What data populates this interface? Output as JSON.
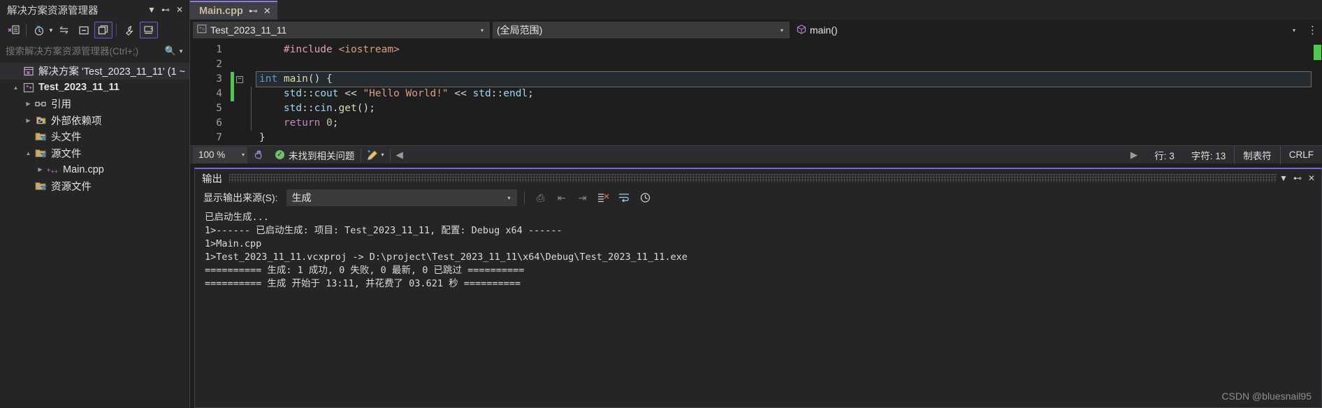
{
  "solution_explorer": {
    "title": "解决方案资源管理器",
    "title_buttons": [
      {
        "name": "dropdown",
        "glyph": "▼"
      },
      {
        "name": "pin",
        "glyph": "⊷"
      },
      {
        "name": "close",
        "glyph": "✕"
      }
    ],
    "toolbar": [
      {
        "name": "home-icon",
        "glyph": "⧉"
      },
      {
        "name": "pending-changes-icon",
        "glyph": "◷"
      },
      {
        "name": "sync-icon",
        "glyph": "⇆"
      },
      {
        "name": "collapse-all-icon",
        "glyph": "⊟"
      },
      {
        "name": "show-all-files-icon",
        "glyph": "❐"
      },
      {
        "name": "properties-icon",
        "glyph": "🔧"
      },
      {
        "name": "preview-icon",
        "glyph": "⛭"
      }
    ],
    "search_placeholder": "搜索解决方案资源管理器(Ctrl+;)",
    "search_value": "",
    "tree": [
      {
        "label": "解决方案 'Test_2023_11_11' (1 ~",
        "indent": 0,
        "expander": "",
        "icon": "solution-icon",
        "bold": false,
        "selected": true
      },
      {
        "label": "Test_2023_11_11",
        "indent": 1,
        "expander": "▲",
        "icon": "cpp-project-icon",
        "bold": true,
        "selected": false
      },
      {
        "label": "引用",
        "indent": 2,
        "expander": "▶",
        "icon": "references-icon",
        "bold": false,
        "selected": false
      },
      {
        "label": "外部依赖项",
        "indent": 2,
        "expander": "▶",
        "icon": "external-deps-icon",
        "bold": false,
        "selected": false
      },
      {
        "label": "头文件",
        "indent": 3,
        "expander": "",
        "icon": "filter-folder-icon",
        "bold": false,
        "selected": false
      },
      {
        "label": "源文件",
        "indent": 2,
        "expander": "▲",
        "icon": "filter-folder-icon",
        "bold": false,
        "selected": false
      },
      {
        "label": "Main.cpp",
        "indent": 3,
        "expander": "▶",
        "icon": "cpp-file-icon",
        "bold": false,
        "selected": false
      },
      {
        "label": "资源文件",
        "indent": 3,
        "expander": "",
        "icon": "filter-folder-icon",
        "bold": false,
        "selected": false
      }
    ]
  },
  "editor": {
    "tab": {
      "label": "Main.cpp",
      "pin_glyph": "⊷",
      "close_glyph": "✕"
    },
    "nav": {
      "project": "Test_2023_11_11",
      "scope": "(全局范围)",
      "member": "main()",
      "caret": "▾",
      "overflow": "⋮"
    },
    "code_lines": [
      {
        "n": "1",
        "changed": false,
        "fold": "",
        "guide": false,
        "highlight": false,
        "tokens": [
          {
            "t": "    ",
            "c": "tok-punct"
          },
          {
            "t": "#include",
            "c": "tok-pre"
          },
          {
            "t": " ",
            "c": "tok-punct"
          },
          {
            "t": "<iostream>",
            "c": "tok-hdr"
          }
        ]
      },
      {
        "n": "2",
        "changed": false,
        "fold": "",
        "guide": false,
        "highlight": false,
        "tokens": []
      },
      {
        "n": "3",
        "changed": true,
        "fold": "−",
        "guide": false,
        "highlight": true,
        "tokens": [
          {
            "t": "int",
            "c": "tok-kw"
          },
          {
            "t": " ",
            "c": "tok-punct"
          },
          {
            "t": "main",
            "c": "tok-fn"
          },
          {
            "t": "() {",
            "c": "tok-brace"
          }
        ]
      },
      {
        "n": "4",
        "changed": true,
        "fold": "",
        "guide": true,
        "highlight": false,
        "tokens": [
          {
            "t": "    ",
            "c": "tok-punct"
          },
          {
            "t": "std",
            "c": "tok-ns"
          },
          {
            "t": "::",
            "c": "tok-punct"
          },
          {
            "t": "cout",
            "c": "tok-ns"
          },
          {
            "t": " << ",
            "c": "tok-op"
          },
          {
            "t": "\"Hello World!\"",
            "c": "tok-str"
          },
          {
            "t": " << ",
            "c": "tok-op"
          },
          {
            "t": "std",
            "c": "tok-ns"
          },
          {
            "t": "::",
            "c": "tok-punct"
          },
          {
            "t": "endl",
            "c": "tok-ns"
          },
          {
            "t": ";",
            "c": "tok-punct"
          }
        ]
      },
      {
        "n": "5",
        "changed": false,
        "fold": "",
        "guide": true,
        "highlight": false,
        "tokens": [
          {
            "t": "    ",
            "c": "tok-punct"
          },
          {
            "t": "std",
            "c": "tok-ns"
          },
          {
            "t": "::",
            "c": "tok-punct"
          },
          {
            "t": "cin",
            "c": "tok-ns"
          },
          {
            "t": ".",
            "c": "tok-punct"
          },
          {
            "t": "get",
            "c": "tok-fn"
          },
          {
            "t": "();",
            "c": "tok-punct"
          }
        ]
      },
      {
        "n": "6",
        "changed": false,
        "fold": "",
        "guide": true,
        "highlight": false,
        "tokens": [
          {
            "t": "    ",
            "c": "tok-punct"
          },
          {
            "t": "return",
            "c": "tok-kwp"
          },
          {
            "t": " ",
            "c": "tok-punct"
          },
          {
            "t": "0",
            "c": "tok-num"
          },
          {
            "t": ";",
            "c": "tok-punct"
          }
        ]
      },
      {
        "n": "7",
        "changed": false,
        "fold": "",
        "guide": false,
        "highlight": false,
        "tokens": [
          {
            "t": "}",
            "c": "tok-brace"
          }
        ]
      }
    ],
    "status": {
      "zoom": "100 %",
      "zoom_caret": "▾",
      "hand_icon": "✋",
      "ok_glyph": "✓",
      "issues": "未找到相关问题",
      "brush_icon": "🖌",
      "brush_caret": "▾",
      "prev_arrow": "◀",
      "next_arrow": "▶",
      "line": "行: 3",
      "column": "字符: 13",
      "tabs": "制表符",
      "eol": "CRLF"
    }
  },
  "output": {
    "title": "输出",
    "header_buttons": [
      {
        "name": "dropdown",
        "glyph": "▼"
      },
      {
        "name": "pin",
        "glyph": "⊷"
      },
      {
        "name": "close",
        "glyph": "✕"
      }
    ],
    "source_label": "显示输出来源(S):",
    "source_value": "生成",
    "source_caret": "▾",
    "toolbar_buttons": [
      {
        "name": "save-output-icon",
        "glyph": "⎙",
        "enabled": false
      },
      {
        "name": "go-to-previous-icon",
        "glyph": "⇤",
        "enabled": false
      },
      {
        "name": "go-to-next-icon",
        "glyph": "⇥",
        "enabled": false
      },
      {
        "name": "clear-all-icon",
        "glyph": "✖",
        "enabled": true
      },
      {
        "name": "toggle-word-wrap-icon",
        "glyph": "⇌",
        "enabled": true
      },
      {
        "name": "history-icon",
        "glyph": "◷",
        "enabled": true
      }
    ],
    "lines": [
      "已启动生成...",
      "1>------ 已启动生成: 项目: Test_2023_11_11, 配置: Debug x64 ------",
      "1>Main.cpp",
      "1>Test_2023_11_11.vcxproj -> D:\\project\\Test_2023_11_11\\x64\\Debug\\Test_2023_11_11.exe",
      "========== 生成: 1 成功, 0 失败, 0 最新, 0 已跳过 ==========",
      "========== 生成 开始于 13:11, 并花费了 03.621 秒 =========="
    ]
  },
  "watermark": "CSDN @bluesnail95",
  "colors": {
    "accent_purple": "#7b68d9",
    "tab_text": "#c8b89a",
    "changed_green": "#4ec94e",
    "ok_green": "#6ec06e"
  }
}
